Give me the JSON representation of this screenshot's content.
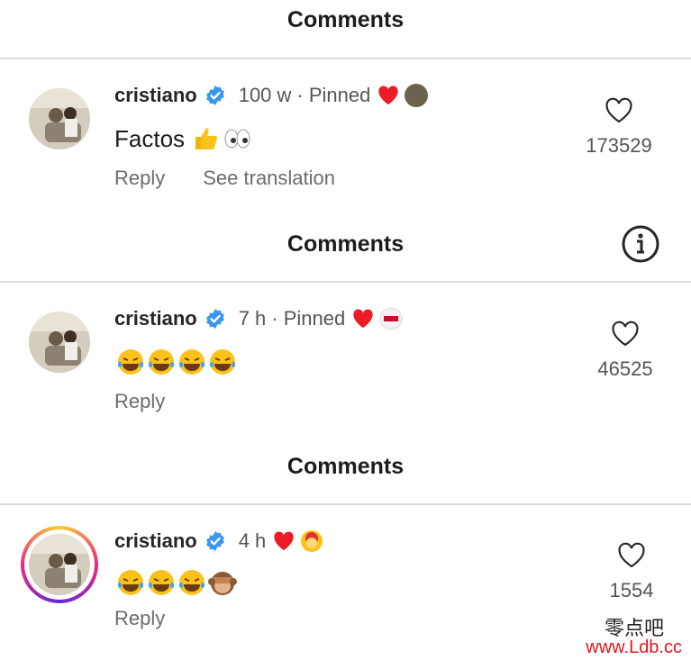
{
  "sections": [
    {
      "header": "Comments",
      "comment": {
        "username": "cristiano",
        "time": "100 w",
        "pinned_text": "· Pinned",
        "text": "Factos",
        "actions": [
          "Reply",
          "See translation"
        ],
        "likes": "173529"
      }
    },
    {
      "header": "Comments",
      "comment": {
        "username": "cristiano",
        "time": "7 h",
        "pinned_text": "· Pinned",
        "text": "",
        "actions": [
          "Reply"
        ],
        "likes": "46525"
      }
    },
    {
      "header": "Comments",
      "comment": {
        "username": "cristiano",
        "time": "4 h",
        "pinned_text": "",
        "text": "",
        "actions": [
          "Reply"
        ],
        "likes": "1554"
      }
    }
  ],
  "watermark": {
    "chinese": "零点吧",
    "url": "www.Ldb.cc"
  },
  "colors": {
    "verified": "#3897f0",
    "heart_red": "#ed1c24",
    "text": "#262626",
    "muted": "#6b6b6b"
  },
  "icons": [
    "verified-badge-icon",
    "red-heart-icon",
    "like-heart-icon",
    "info-icon",
    "thumbs-up-emoji",
    "eyes-emoji",
    "tears-of-joy-emoji",
    "see-no-evil-monkey-emoji"
  ]
}
